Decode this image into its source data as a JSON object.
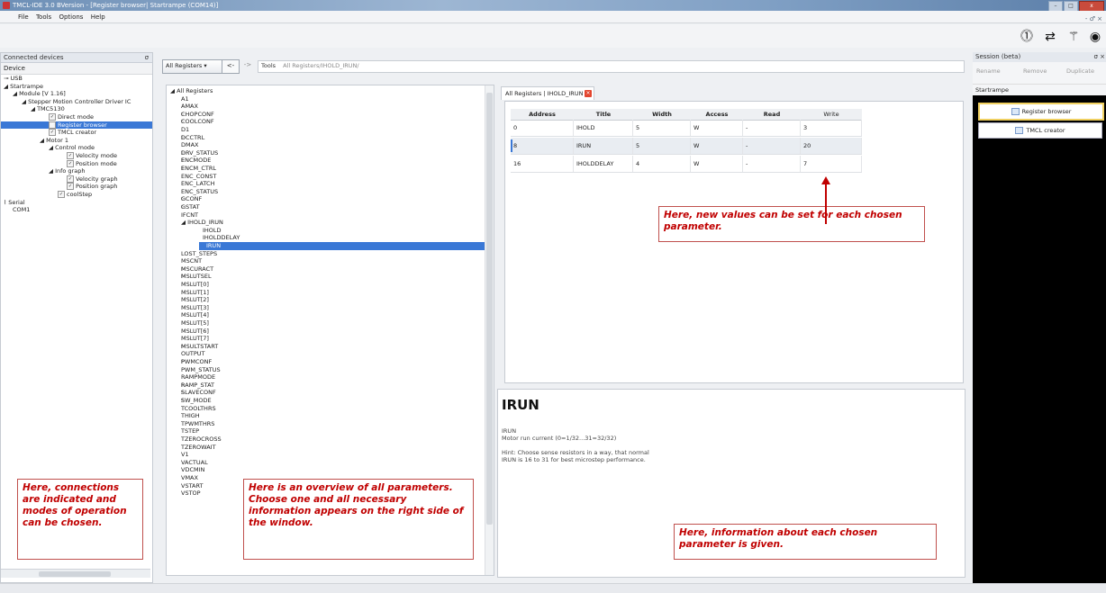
{
  "window": {
    "title": "TMCL-IDE 3.0 BVersion - [Register browser| Startrampe (COM14)]",
    "min": "–",
    "max": "□",
    "close": "x",
    "mdi": "- ♂ ×"
  },
  "menu": [
    "File",
    "Tools",
    "Options",
    "Help"
  ],
  "toolbar_icons": [
    "download-icon",
    "transfer-icon",
    "wand-icon",
    "eye-icon"
  ],
  "left_panel": {
    "title": "Connected devices",
    "pin": "σ",
    "header": "Device",
    "tree": [
      {
        "text": "USB",
        "indent": 0,
        "prefix": "⊸"
      },
      {
        "text": "◢ Startrampe",
        "indent": 0
      },
      {
        "text": "◢ Module [V 1.16]",
        "indent": 1
      },
      {
        "text": "◢ Stepper Motion Controller Driver IC",
        "indent": 2
      },
      {
        "text": "◢ TMC5130",
        "indent": 3
      },
      {
        "text": "Direct mode",
        "indent": 5,
        "check": true
      },
      {
        "text": "Register browser",
        "indent": 5,
        "check": true,
        "selected": true
      },
      {
        "text": "TMCL creator",
        "indent": 5,
        "check": true
      },
      {
        "text": "◢ Motor 1",
        "indent": 4
      },
      {
        "text": "◢ Control mode",
        "indent": 5
      },
      {
        "text": "Velocity mode",
        "indent": 7,
        "check": true
      },
      {
        "text": "Position mode",
        "indent": 7,
        "check": true
      },
      {
        "text": "◢ Info graph",
        "indent": 5
      },
      {
        "text": "Velocity graph",
        "indent": 7,
        "check": true
      },
      {
        "text": "Position graph",
        "indent": 7,
        "check": true
      },
      {
        "text": "coolStep",
        "indent": 6,
        "check": true
      },
      {
        "text": "Serial",
        "indent": 0,
        "prefix": "⌇"
      },
      {
        "text": "COM1",
        "indent": 1
      }
    ]
  },
  "midbar": {
    "combo": "All Registers",
    "back": "<-",
    "forward": "->",
    "tools_label": "Tools",
    "path": "All Registers/IHOLD_IRUN/"
  },
  "register_list": {
    "root": "◢ All Registers",
    "items": [
      {
        "text": "A1",
        "level": 1
      },
      {
        "text": "AMAX",
        "level": 1
      },
      {
        "text": "CHOPCONF",
        "level": 1,
        "expand": true
      },
      {
        "text": "COOLCONF",
        "level": 1,
        "expand": true
      },
      {
        "text": "D1",
        "level": 1
      },
      {
        "text": "DCCTRL",
        "level": 1,
        "expand": true
      },
      {
        "text": "DMAX",
        "level": 1
      },
      {
        "text": "DRV_STATUS",
        "level": 1,
        "expand": true
      },
      {
        "text": "ENCMODE",
        "level": 1,
        "expand": true
      },
      {
        "text": "ENCM_CTRL",
        "level": 1,
        "expand": true
      },
      {
        "text": "ENC_CONST",
        "level": 1
      },
      {
        "text": "ENC_LATCH",
        "level": 1
      },
      {
        "text": "ENC_STATUS",
        "level": 1
      },
      {
        "text": "GCONF",
        "level": 1,
        "expand": true
      },
      {
        "text": "GSTAT",
        "level": 1,
        "expand": true
      },
      {
        "text": "IFCNT",
        "level": 1
      },
      {
        "text": "◢ IHOLD_IRUN",
        "level": 1
      },
      {
        "text": "IHOLD",
        "level": 2
      },
      {
        "text": "IHOLDDELAY",
        "level": 2
      },
      {
        "text": "IRUN",
        "level": 2,
        "selected": true
      },
      {
        "text": "LOST_STEPS",
        "level": 1
      },
      {
        "text": "MSCNT",
        "level": 1
      },
      {
        "text": "MSCURACT",
        "level": 1,
        "expand": true
      },
      {
        "text": "MSLUTSEL",
        "level": 1,
        "expand": true
      },
      {
        "text": "MSLUT[0]",
        "level": 1
      },
      {
        "text": "MSLUT[1]",
        "level": 1
      },
      {
        "text": "MSLUT[2]",
        "level": 1
      },
      {
        "text": "MSLUT[3]",
        "level": 1
      },
      {
        "text": "MSLUT[4]",
        "level": 1
      },
      {
        "text": "MSLUT[5]",
        "level": 1
      },
      {
        "text": "MSLUT[6]",
        "level": 1
      },
      {
        "text": "MSLUT[7]",
        "level": 1
      },
      {
        "text": "MSULTSTART",
        "level": 1,
        "expand": true
      },
      {
        "text": "OUTPUT",
        "level": 1
      },
      {
        "text": "PWMCONF",
        "level": 1,
        "expand": true
      },
      {
        "text": "PWM_STATUS",
        "level": 1
      },
      {
        "text": "RAMPMODE",
        "level": 1
      },
      {
        "text": "RAMP_STAT",
        "level": 1,
        "expand": true
      },
      {
        "text": "SLAVECONF",
        "level": 1,
        "expand": true
      },
      {
        "text": "SW_MODE",
        "level": 1,
        "expand": true
      },
      {
        "text": "TCOOLTHRS",
        "level": 1
      },
      {
        "text": "THIGH",
        "level": 1
      },
      {
        "text": "TPWMTHRS",
        "level": 1
      },
      {
        "text": "TSTEP",
        "level": 1
      },
      {
        "text": "TZEROCROSS",
        "level": 1
      },
      {
        "text": "TZEROWAIT",
        "level": 1
      },
      {
        "text": "V1",
        "level": 1
      },
      {
        "text": "VACTUAL",
        "level": 1
      },
      {
        "text": "VDCMIN",
        "level": 1
      },
      {
        "text": "VMAX",
        "level": 1
      },
      {
        "text": "VSTART",
        "level": 1
      },
      {
        "text": "VSTOP",
        "level": 1
      }
    ]
  },
  "tab": {
    "label": "All Registers | IHOLD_IRUN",
    "close": "×"
  },
  "table": {
    "headers": [
      "Address",
      "Title",
      "Width",
      "Access",
      "Read",
      "Write"
    ],
    "rows": [
      [
        "0",
        "IHOLD",
        "5",
        "W",
        "-",
        "3"
      ],
      [
        "8",
        "IRUN",
        "5",
        "W",
        "-",
        "20"
      ],
      [
        "16",
        "IHOLDDELAY",
        "4",
        "W",
        "-",
        "7"
      ]
    ]
  },
  "info": {
    "title": "IRUN",
    "name": "IRUN",
    "desc": "Motor run current (0=1/32...31=32/32)",
    "hint1": "Hint: Choose sense resistors in a way, that normal",
    "hint2": "IRUN is 16 to 31 for best microstep performance."
  },
  "session": {
    "title": "Session (beta)",
    "pin": "σ ×",
    "buttons": [
      "Rename",
      "Remove",
      "Duplicate"
    ],
    "name": "Startrampe",
    "items": [
      "Register browser",
      "TMCL creator"
    ]
  },
  "annotations": {
    "left": "Here, connections are indicated and modes of operation can be chosen.",
    "middle": "Here is an overview of all parameters. Choose one and all necessary information appears on the right side of the window.",
    "table": "Here, new values can be set for each chosen parameter.",
    "info": "Here, information about each chosen parameter is given."
  },
  "colors": {
    "accent": "#3a78d6",
    "annotation": "#c00000",
    "tab_close": "#e3462f"
  }
}
